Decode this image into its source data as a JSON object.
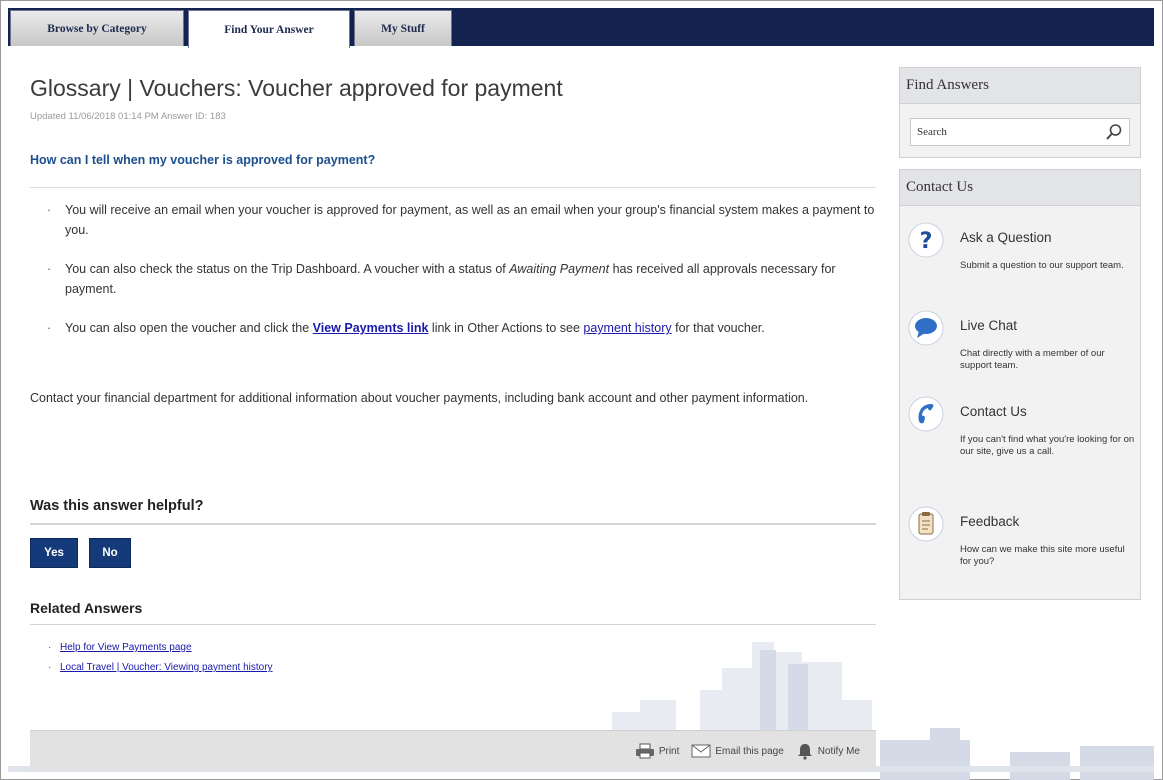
{
  "nav": {
    "tabs": [
      {
        "label": "Browse by Category"
      },
      {
        "label": "Find Your Answer"
      },
      {
        "label": "My Stuff"
      }
    ]
  },
  "article": {
    "title": "Glossary | Vouchers: Voucher approved for payment",
    "meta": "Updated 11/06/2018 01:14 PM   Answer ID: 183",
    "question": "How can I tell when my voucher is approved for payment?",
    "bullet1": "You will receive an email when your voucher is approved for payment, as well as an email when your group's financial system makes a payment to you.",
    "bullet2_a": "You can also check the status on the Trip Dashboard. A voucher with a status of ",
    "bullet2_em": "Awaiting Payment",
    "bullet2_b": " has received all approvals necessary for payment.",
    "bullet3_a": "You can also open the voucher and click the ",
    "bullet3_link": "View Payments link",
    "bullet3_b": " link in Other Actions to see ",
    "bullet3_link2": "payment history",
    "bullet3_c": " for that voucher.",
    "paragraph": "Contact your financial department for additional information about voucher payments, including bank account and other payment information."
  },
  "feedback": {
    "question": "Was this answer helpful?",
    "yes": "Yes",
    "no": "No"
  },
  "related": {
    "heading": "Related Answers",
    "links": [
      {
        "label": "Help for View Payments page"
      },
      {
        "label": "Local Travel | Voucher: Viewing payment history"
      }
    ]
  },
  "footer": {
    "print": "Print",
    "email": "Email this page",
    "notify": "Notify Me"
  },
  "sidebar": {
    "find": {
      "heading": "Find Answers",
      "search_label": "Search"
    },
    "contact": {
      "heading": "Contact Us",
      "items": [
        {
          "title": "Ask a Question",
          "desc": "Submit a question to our support team.",
          "icon": "question-icon"
        },
        {
          "title": "Live Chat",
          "desc": "Chat directly with a member of our support team.",
          "icon": "chat-bubble-icon"
        },
        {
          "title": "Contact Us",
          "desc": "If you can't find what you're looking for on our site, give us a call.",
          "icon": "phone-icon"
        },
        {
          "title": "Feedback",
          "desc": "How can we make this site more useful for you?",
          "icon": "clipboard-icon"
        }
      ]
    }
  },
  "colors": {
    "nav_bg": "#14224f",
    "accent": "#143a7a",
    "question": "#1b4f8d",
    "link": "#1a1aaa"
  }
}
